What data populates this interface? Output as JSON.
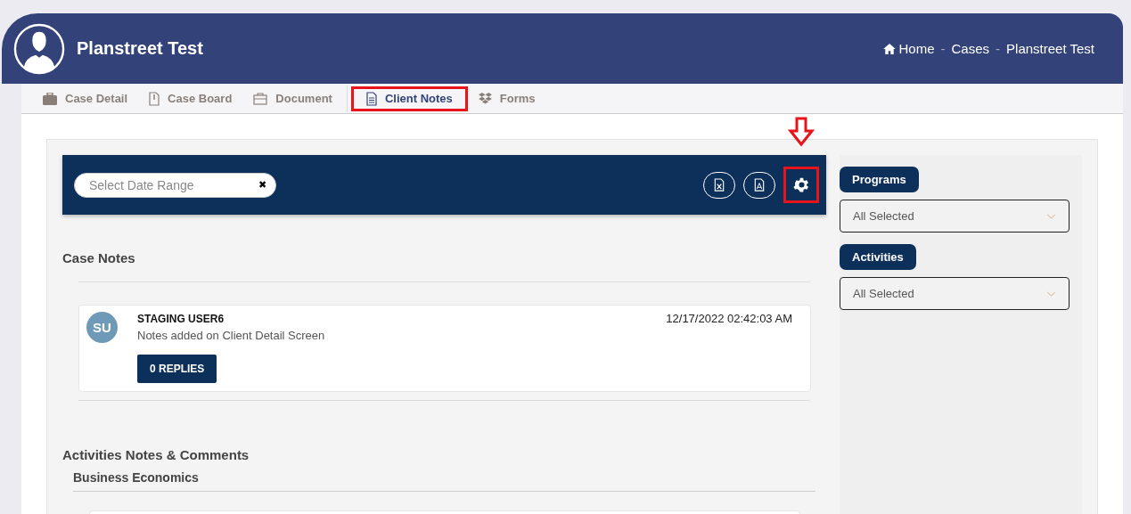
{
  "header": {
    "title": "Planstreet Test",
    "breadcrumb": [
      {
        "label": "Home"
      },
      {
        "separator": "-",
        "label": "Cases"
      },
      {
        "separator": "-",
        "label": "Planstreet Test"
      }
    ]
  },
  "tabs": [
    {
      "label": "Case Detail",
      "kind": "briefcase",
      "selected": false,
      "highlighted": false
    },
    {
      "label": "Case Board",
      "kind": "file",
      "selected": false,
      "highlighted": false
    },
    {
      "label": "Document",
      "kind": "case",
      "selected": false,
      "highlighted": false
    },
    {
      "label": "Client Notes",
      "kind": "note",
      "selected": true,
      "highlighted": true
    },
    {
      "label": "Forms",
      "kind": "box",
      "selected": false,
      "highlighted": false
    }
  ],
  "toolbar": {
    "date_range": {
      "placeholder": "Select Date Range",
      "clear": "✖"
    },
    "settings_highlighted": true
  },
  "case_notes": {
    "title": "Case Notes",
    "notes": [
      {
        "initials": "SU",
        "author": "STAGING USER6",
        "text": "Notes added on Client Detail Screen",
        "time": "12/17/2022 02:42:03 AM",
        "replies": "0 REPLIES"
      }
    ]
  },
  "activities": {
    "title": "Activities Notes & Comments",
    "subtitle": "Business Economics"
  },
  "filters": [
    {
      "label": "Programs",
      "value": "All Selected"
    },
    {
      "label": "Activities",
      "value": "All Selected"
    }
  ]
}
